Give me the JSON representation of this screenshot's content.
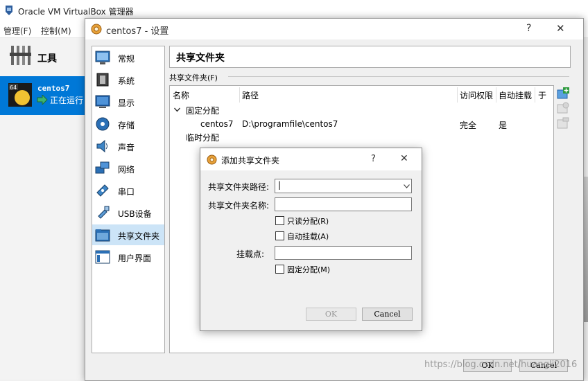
{
  "main_window": {
    "title": "Oracle VM VirtualBox 管理器",
    "menu": [
      "管理(F)",
      "控制(M)"
    ],
    "tools_label": "工具",
    "vm": {
      "badge": "64",
      "name": "centos7",
      "status": "正在运行"
    }
  },
  "settings": {
    "title": "centos7 - 设置",
    "help": "?",
    "close": "✕",
    "sidebar": [
      {
        "label": "常规"
      },
      {
        "label": "系统"
      },
      {
        "label": "显示"
      },
      {
        "label": "存储"
      },
      {
        "label": "声音"
      },
      {
        "label": "网络"
      },
      {
        "label": "串口"
      },
      {
        "label": "USB设备"
      },
      {
        "label": "共享文件夹"
      },
      {
        "label": "用户界面"
      }
    ],
    "selected_index": 8,
    "page_title": "共享文件夹",
    "section_label": "共享文件夹(F)",
    "table": {
      "columns": [
        "名称",
        "路径",
        "访问权限",
        "自动挂载",
        "于"
      ],
      "group_fixed": "固定分配",
      "rows": [
        {
          "name": "centos7",
          "path": "D:\\programfile\\centos7",
          "access": "完全",
          "auto": "是"
        }
      ],
      "group_temp": "临时分配"
    },
    "ok": "OK",
    "cancel": "Cancel"
  },
  "add_dialog": {
    "title": "添加共享文件夹",
    "help": "?",
    "close": "✕",
    "path_label": "共享文件夹路径:",
    "path_value": "|",
    "name_label": "共享文件夹名称:",
    "readonly_label": "只读分配(R)",
    "automount_label": "自动挂载(A)",
    "mount_label": "挂载点:",
    "permanent_label": "固定分配(M)",
    "ok": "OK",
    "cancel": "Cancel"
  },
  "watermark": "https://blog.csdn.net/huangli2016",
  "colors": {
    "accent": "#0078d7",
    "selection": "#cce4f7",
    "add_icon": "#2e9a3e"
  }
}
